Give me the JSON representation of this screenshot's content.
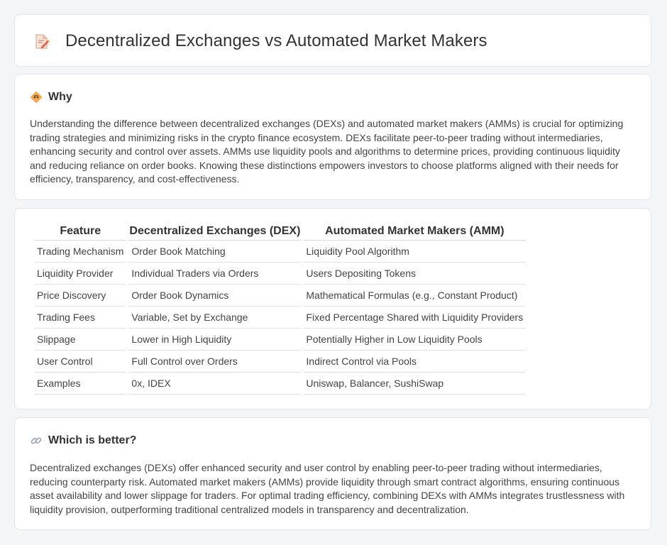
{
  "page": {
    "title": "Decentralized Exchanges vs Automated Market Makers",
    "title_icon": "document-edit-icon"
  },
  "why": {
    "heading": "Why",
    "icon": "diamond-sign-icon",
    "text": "Understanding the difference between decentralized exchanges (DEXs) and automated market makers (AMMs) is crucial for optimizing trading strategies and minimizing risks in the crypto finance ecosystem. DEXs facilitate peer-to-peer trading without intermediaries, enhancing security and control over assets. AMMs use liquidity pools and algorithms to determine prices, providing continuous liquidity and reducing reliance on order books. Knowing these distinctions empowers investors to choose platforms aligned with their needs for efficiency, transparency, and cost-effectiveness."
  },
  "comparison": {
    "headers": [
      "Feature",
      "Decentralized Exchanges (DEX)",
      "Automated Market Makers (AMM)"
    ],
    "rows": [
      [
        "Trading Mechanism",
        "Order Book Matching",
        "Liquidity Pool Algorithm"
      ],
      [
        "Liquidity Provider",
        "Individual Traders via Orders",
        "Users Depositing Tokens"
      ],
      [
        "Price Discovery",
        "Order Book Dynamics",
        "Mathematical Formulas (e.g., Constant Product)"
      ],
      [
        "Trading Fees",
        "Variable, Set by Exchange",
        "Fixed Percentage Shared with Liquidity Providers"
      ],
      [
        "Slippage",
        "Lower in High Liquidity",
        "Potentially Higher in Low Liquidity Pools"
      ],
      [
        "User Control",
        "Full Control over Orders",
        "Indirect Control via Pools"
      ],
      [
        "Examples",
        "0x, IDEX",
        "Uniswap, Balancer, SushiSwap"
      ]
    ]
  },
  "better": {
    "heading": "Which is better?",
    "icon": "link-icon",
    "text": "Decentralized exchanges (DEXs) offer enhanced security and user control by enabling peer-to-peer trading without intermediaries, reducing counterparty risk. Automated market makers (AMMs) provide liquidity through smart contract algorithms, ensuring continuous asset availability and lower slippage for traders. For optimal trading efficiency, combining DEXs with AMMs integrates trustlessness with liquidity provision, outperforming traditional centralized models in transparency and decentralization."
  },
  "colors": {
    "background": "#f4f5f7",
    "card": "#ffffff",
    "icon_accent": "#f0a35a"
  }
}
